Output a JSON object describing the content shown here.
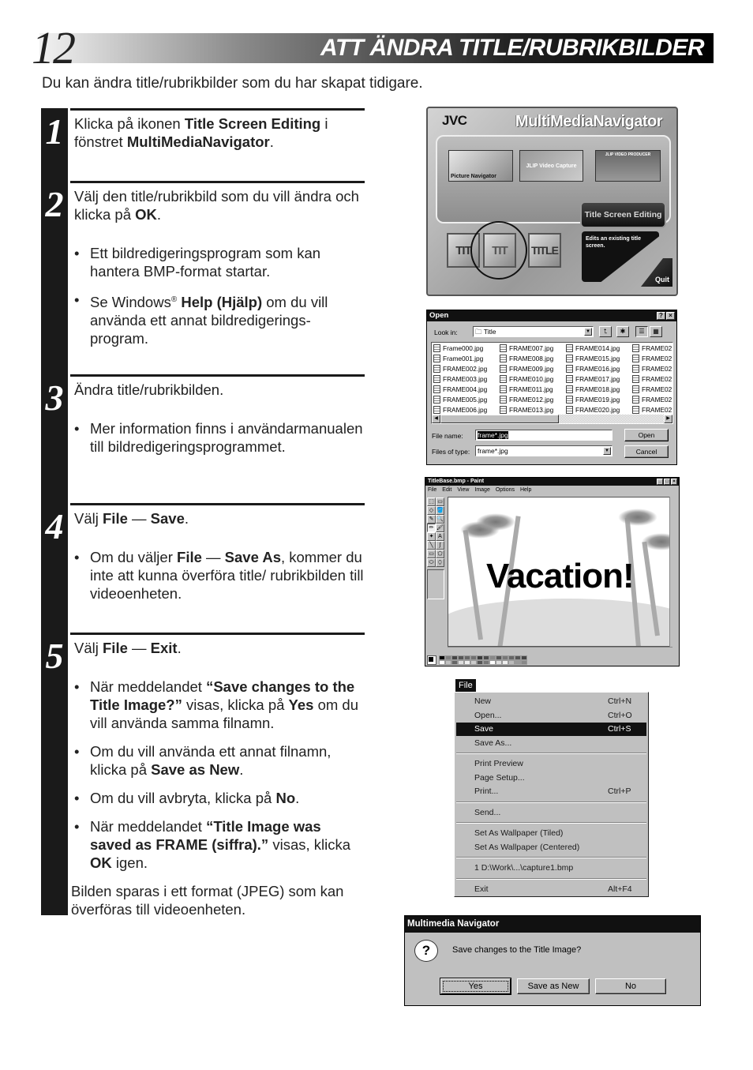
{
  "header": {
    "page_number": "12",
    "title": "ATT ÄNDRA TITLE/RUBRIKBILDER"
  },
  "intro": "Du kan ändra title/rubrikbilder som du har skapat tidigare.",
  "steps": [
    {
      "number": "1",
      "text_parts": [
        "Klicka på ikonen ",
        "Title Screen Editing",
        " i fönstret ",
        "MultiMediaNavigator",
        "."
      ]
    },
    {
      "number": "2",
      "text_parts": [
        "Välj den title/rubrikbild som du vill ändra och klicka på ",
        "OK",
        "."
      ],
      "bullets": [
        {
          "parts": [
            "Ett bildredigeringsprogram som kan hantera BMP-format startar."
          ]
        },
        {
          "parts": [
            "Se Windows",
            "®",
            " ",
            "Help (Hjälp)",
            " om du vill använda ett annat bildredigerings-program."
          ]
        }
      ]
    },
    {
      "number": "3",
      "text_parts": [
        "Ändra title/rubrikbilden."
      ],
      "bullets": [
        {
          "parts": [
            "Mer information finns i användarmanualen till bildredigeringsprogrammet."
          ]
        }
      ]
    },
    {
      "number": "4",
      "text_parts": [
        "Välj ",
        "File",
        " — ",
        "Save",
        "."
      ],
      "bullets": [
        {
          "parts": [
            "Om du väljer ",
            "File",
            " — ",
            "Save As",
            ", kommer du inte att kunna överföra title/ rubrikbilden till videoenheten."
          ]
        }
      ]
    },
    {
      "number": "5",
      "text_parts": [
        "Välj ",
        "File",
        " — ",
        "Exit",
        "."
      ],
      "bullets": [
        {
          "parts": [
            "När meddelandet ",
            "“Save changes to the Title Image?”",
            " visas, klicka på ",
            "Yes",
            " om du vill använda samma filnamn."
          ]
        },
        {
          "parts": [
            "Om du vill använda ett annat filnamn, klicka på ",
            "Save as New",
            "."
          ]
        },
        {
          "parts": [
            "Om du vill avbryta, klicka på ",
            "No",
            "."
          ]
        },
        {
          "parts": [
            "När meddelandet ",
            "“Title Image was saved as FRAME (siffra).”",
            " visas, klicka ",
            "OK",
            " igen."
          ]
        }
      ],
      "closing": "Bilden sparas i ett format (JPEG) som kan överföras till videoenheten."
    }
  ],
  "multimedia_navigator": {
    "brand": "JVC",
    "title": "MultiMediaNavigator",
    "tiles": [
      "Picture Navigator",
      "JLIP Video Capture",
      "JLIP VIDEO PRODUCER"
    ],
    "selected_function": "Title Screen Editing",
    "description": "Edits an existing title screen.",
    "quit_label": "Quit",
    "icons": [
      "TIT",
      "TIT",
      "TITLE"
    ]
  },
  "open_dialog": {
    "title": "Open",
    "help_btn": "?",
    "close_btn": "×",
    "look_in_label": "Look in:",
    "look_in_value": "Title",
    "files": [
      "Frame000.jpg",
      "Frame001.jpg",
      "FRAME002.jpg",
      "FRAME003.jpg",
      "FRAME004.jpg",
      "FRAME005.jpg",
      "FRAME006.jpg",
      "FRAME007.jpg",
      "FRAME008.jpg",
      "FRAME009.jpg",
      "FRAME010.jpg",
      "FRAME011.jpg",
      "FRAME012.jpg",
      "FRAME013.jpg",
      "FRAME014.jpg",
      "FRAME015.jpg",
      "FRAME016.jpg",
      "FRAME017.jpg",
      "FRAME018.jpg",
      "FRAME019.jpg",
      "FRAME020.jpg",
      "FRAME02",
      "FRAME02",
      "FRAME02",
      "FRAME02",
      "FRAME02",
      "FRAME02",
      "FRAME02"
    ],
    "file_name_label": "File name:",
    "file_name_value": "frame*.jpg",
    "file_type_label": "Files of type:",
    "file_type_value": "frame*.jpg",
    "open_btn": "Open",
    "cancel_btn": "Cancel"
  },
  "paint": {
    "title": "TitleBase.bmp - Paint",
    "menu": [
      "File",
      "Edit",
      "View",
      "Image",
      "Options",
      "Help"
    ],
    "tools": [
      "⬚",
      "▭",
      "◇",
      "🪣",
      "✎",
      "🔍",
      "✏",
      "🖌",
      "✦",
      "A",
      "╲",
      "∫",
      "▭",
      "⬠",
      "⬭",
      "⬯"
    ],
    "canvas_text": "Vacation!"
  },
  "file_menu": {
    "header": "File",
    "items": [
      {
        "label": "New",
        "shortcut": "Ctrl+N"
      },
      {
        "label": "Open...",
        "shortcut": "Ctrl+O"
      },
      {
        "label": "Save",
        "shortcut": "Ctrl+S",
        "highlighted": true
      },
      {
        "label": "Save As...",
        "shortcut": ""
      },
      {
        "label": "Print Preview",
        "shortcut": ""
      },
      {
        "label": "Page Setup...",
        "shortcut": ""
      },
      {
        "label": "Print...",
        "shortcut": "Ctrl+P"
      },
      {
        "label": "Send...",
        "shortcut": ""
      },
      {
        "label": "Set As Wallpaper (Tiled)",
        "shortcut": ""
      },
      {
        "label": "Set As Wallpaper (Centered)",
        "shortcut": ""
      },
      {
        "label": "1 D:\\Work\\...\\capture1.bmp",
        "shortcut": ""
      },
      {
        "label": "Exit",
        "shortcut": "Alt+F4"
      }
    ]
  },
  "confirm_dialog": {
    "title": "Multimedia Navigator",
    "icon": "?",
    "message": "Save changes to the Title Image?",
    "buttons": [
      "Yes",
      "Save as New",
      "No"
    ]
  }
}
